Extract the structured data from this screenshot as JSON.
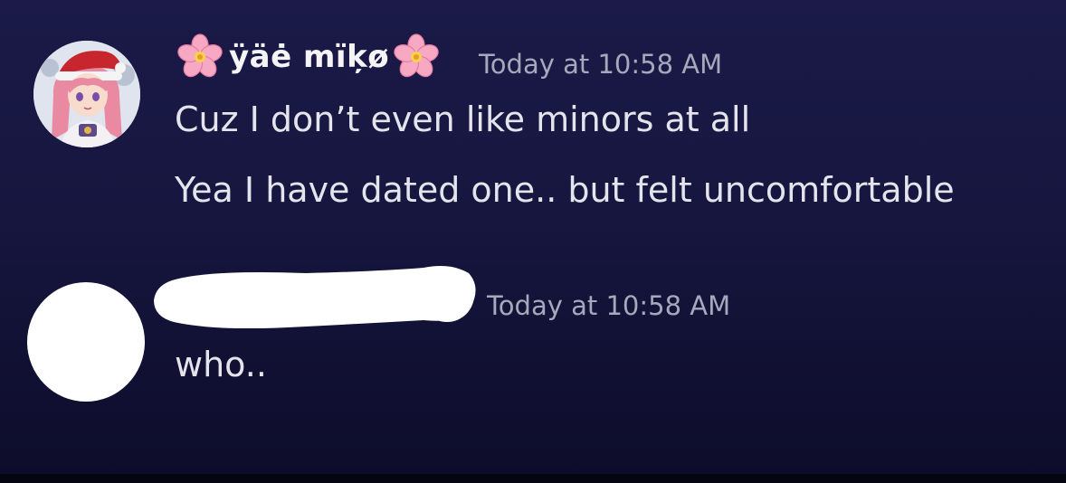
{
  "messages": [
    {
      "username": "ÿäė mïķø",
      "username_emoji": "cherry-blossom",
      "timestamp": "Today at 10:58 AM",
      "lines": [
        "Cuz I don’t even like minors at all",
        "Yea I have dated one.. but felt uncomfortable"
      ]
    },
    {
      "username_redacted": true,
      "timestamp": "Today at 10:58 AM",
      "lines": [
        "who.."
      ]
    }
  ],
  "colors": {
    "background_top": "#1b1a48",
    "background_bottom": "#0d0c2a",
    "username": "#f4f4f6",
    "timestamp": "#a6a8bb",
    "message_text": "#e4e4ec",
    "redaction": "#ffffff"
  }
}
